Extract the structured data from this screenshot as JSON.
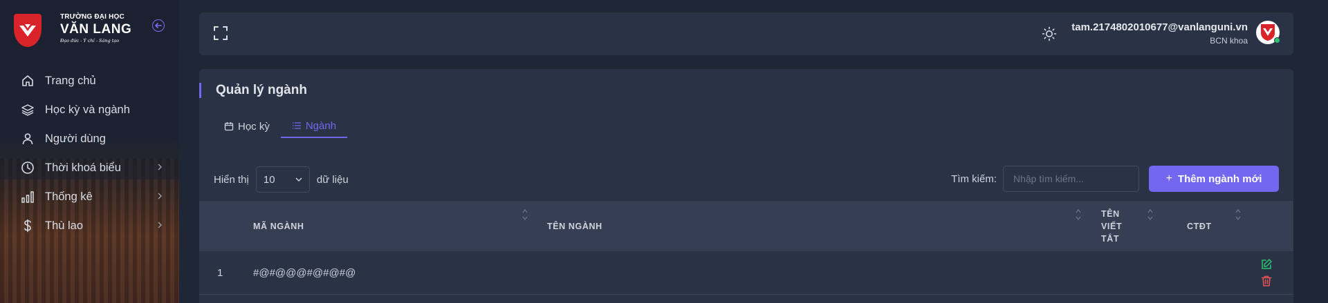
{
  "brand": {
    "line1": "TRƯỜNG ĐẠI HỌC",
    "line2": "VĂN LANG",
    "line3": "Đạo đức - Ý chí - Sáng tạo"
  },
  "sidebar": {
    "items": [
      {
        "label": "Trang chủ",
        "icon": "home-icon",
        "has_submenu": false
      },
      {
        "label": "Học kỳ và ngành",
        "icon": "layers-icon",
        "has_submenu": false
      },
      {
        "label": "Người dùng",
        "icon": "user-icon",
        "has_submenu": false
      },
      {
        "label": "Thời khoá biểu",
        "icon": "clock-icon",
        "has_submenu": true
      },
      {
        "label": "Thống kê",
        "icon": "bar-chart-icon",
        "has_submenu": true
      },
      {
        "label": "Thù lao",
        "icon": "dollar-icon",
        "has_submenu": true
      }
    ]
  },
  "topbar": {
    "user_email": "tam.2174802010677@vanlanguni.vn",
    "user_role": "BCN khoa",
    "online_color": "#28c76f"
  },
  "page": {
    "title": "Quản lý ngành",
    "tabs": [
      {
        "label": "Học kỳ",
        "icon": "calendar-icon",
        "active": false
      },
      {
        "label": "Ngành",
        "icon": "list-icon",
        "active": true
      }
    ]
  },
  "controls": {
    "show_label": "Hiển thị",
    "page_size": "10",
    "page_size_suffix": "dữ liệu",
    "search_label": "Tìm kiếm:",
    "search_placeholder": "Nhập tìm kiếm...",
    "add_button": "Thêm ngành mới"
  },
  "table": {
    "columns": [
      "MÃ NGÀNH",
      "TÊN NGÀNH",
      "TÊN VIẾT TẮT",
      "CTĐT"
    ],
    "rows": [
      {
        "index": "1",
        "code": "#@#@@@#@#@#@",
        "name": "",
        "abbr": "",
        "program": ""
      }
    ]
  },
  "colors": {
    "accent": "#7367f0",
    "brand_red": "#d8232a",
    "edit": "#28c76f",
    "delete": "#ea5455"
  }
}
